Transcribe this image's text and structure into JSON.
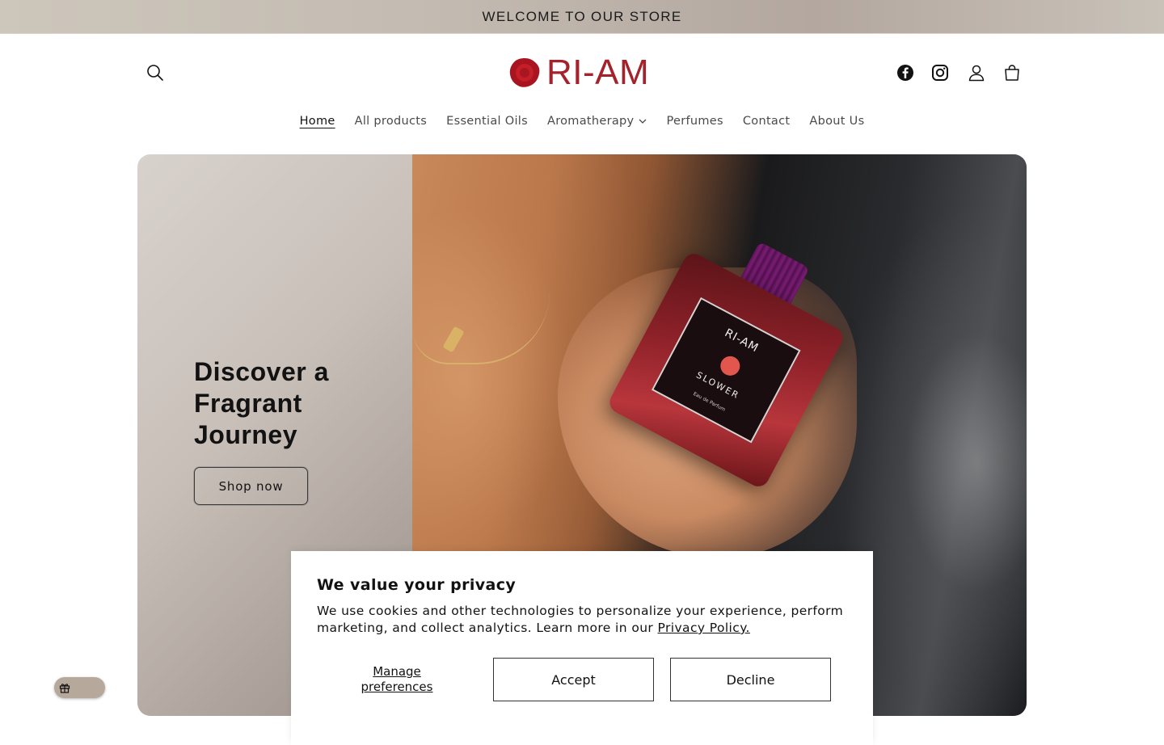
{
  "announcement": {
    "text": "WELCOME TO OUR STORE"
  },
  "header": {
    "logo_text": "RI-AM",
    "icons": [
      "search-icon",
      "facebook-icon",
      "instagram-icon",
      "account-icon",
      "cart-icon"
    ]
  },
  "nav": {
    "items": [
      {
        "label": "Home",
        "active": true
      },
      {
        "label": "All products"
      },
      {
        "label": "Essential Oils"
      },
      {
        "label": "Aromatherapy",
        "has_dropdown": true
      },
      {
        "label": "Perfumes"
      },
      {
        "label": "Contact"
      },
      {
        "label": "About Us"
      }
    ]
  },
  "hero": {
    "heading": "Discover a Fragrant Journey",
    "button_label": "Shop now",
    "bottle_label": {
      "brand": "RI-AM",
      "name": "SLOWER",
      "sub": "Eau de Parfum"
    }
  },
  "cookie_banner": {
    "title": "We value your privacy",
    "text": "We use cookies and other technologies to personalize your experience, perform marketing, and collect analytics. Learn more in our ",
    "link_text": "Privacy Policy.",
    "manage_label": "Manage preferences",
    "accept_label": "Accept",
    "decline_label": "Decline"
  },
  "colors": {
    "brand_red": "#a3222c",
    "announcement_bg": "#c4bcb2",
    "text": "#121212"
  },
  "floating": {
    "icon": "gift-icon"
  }
}
